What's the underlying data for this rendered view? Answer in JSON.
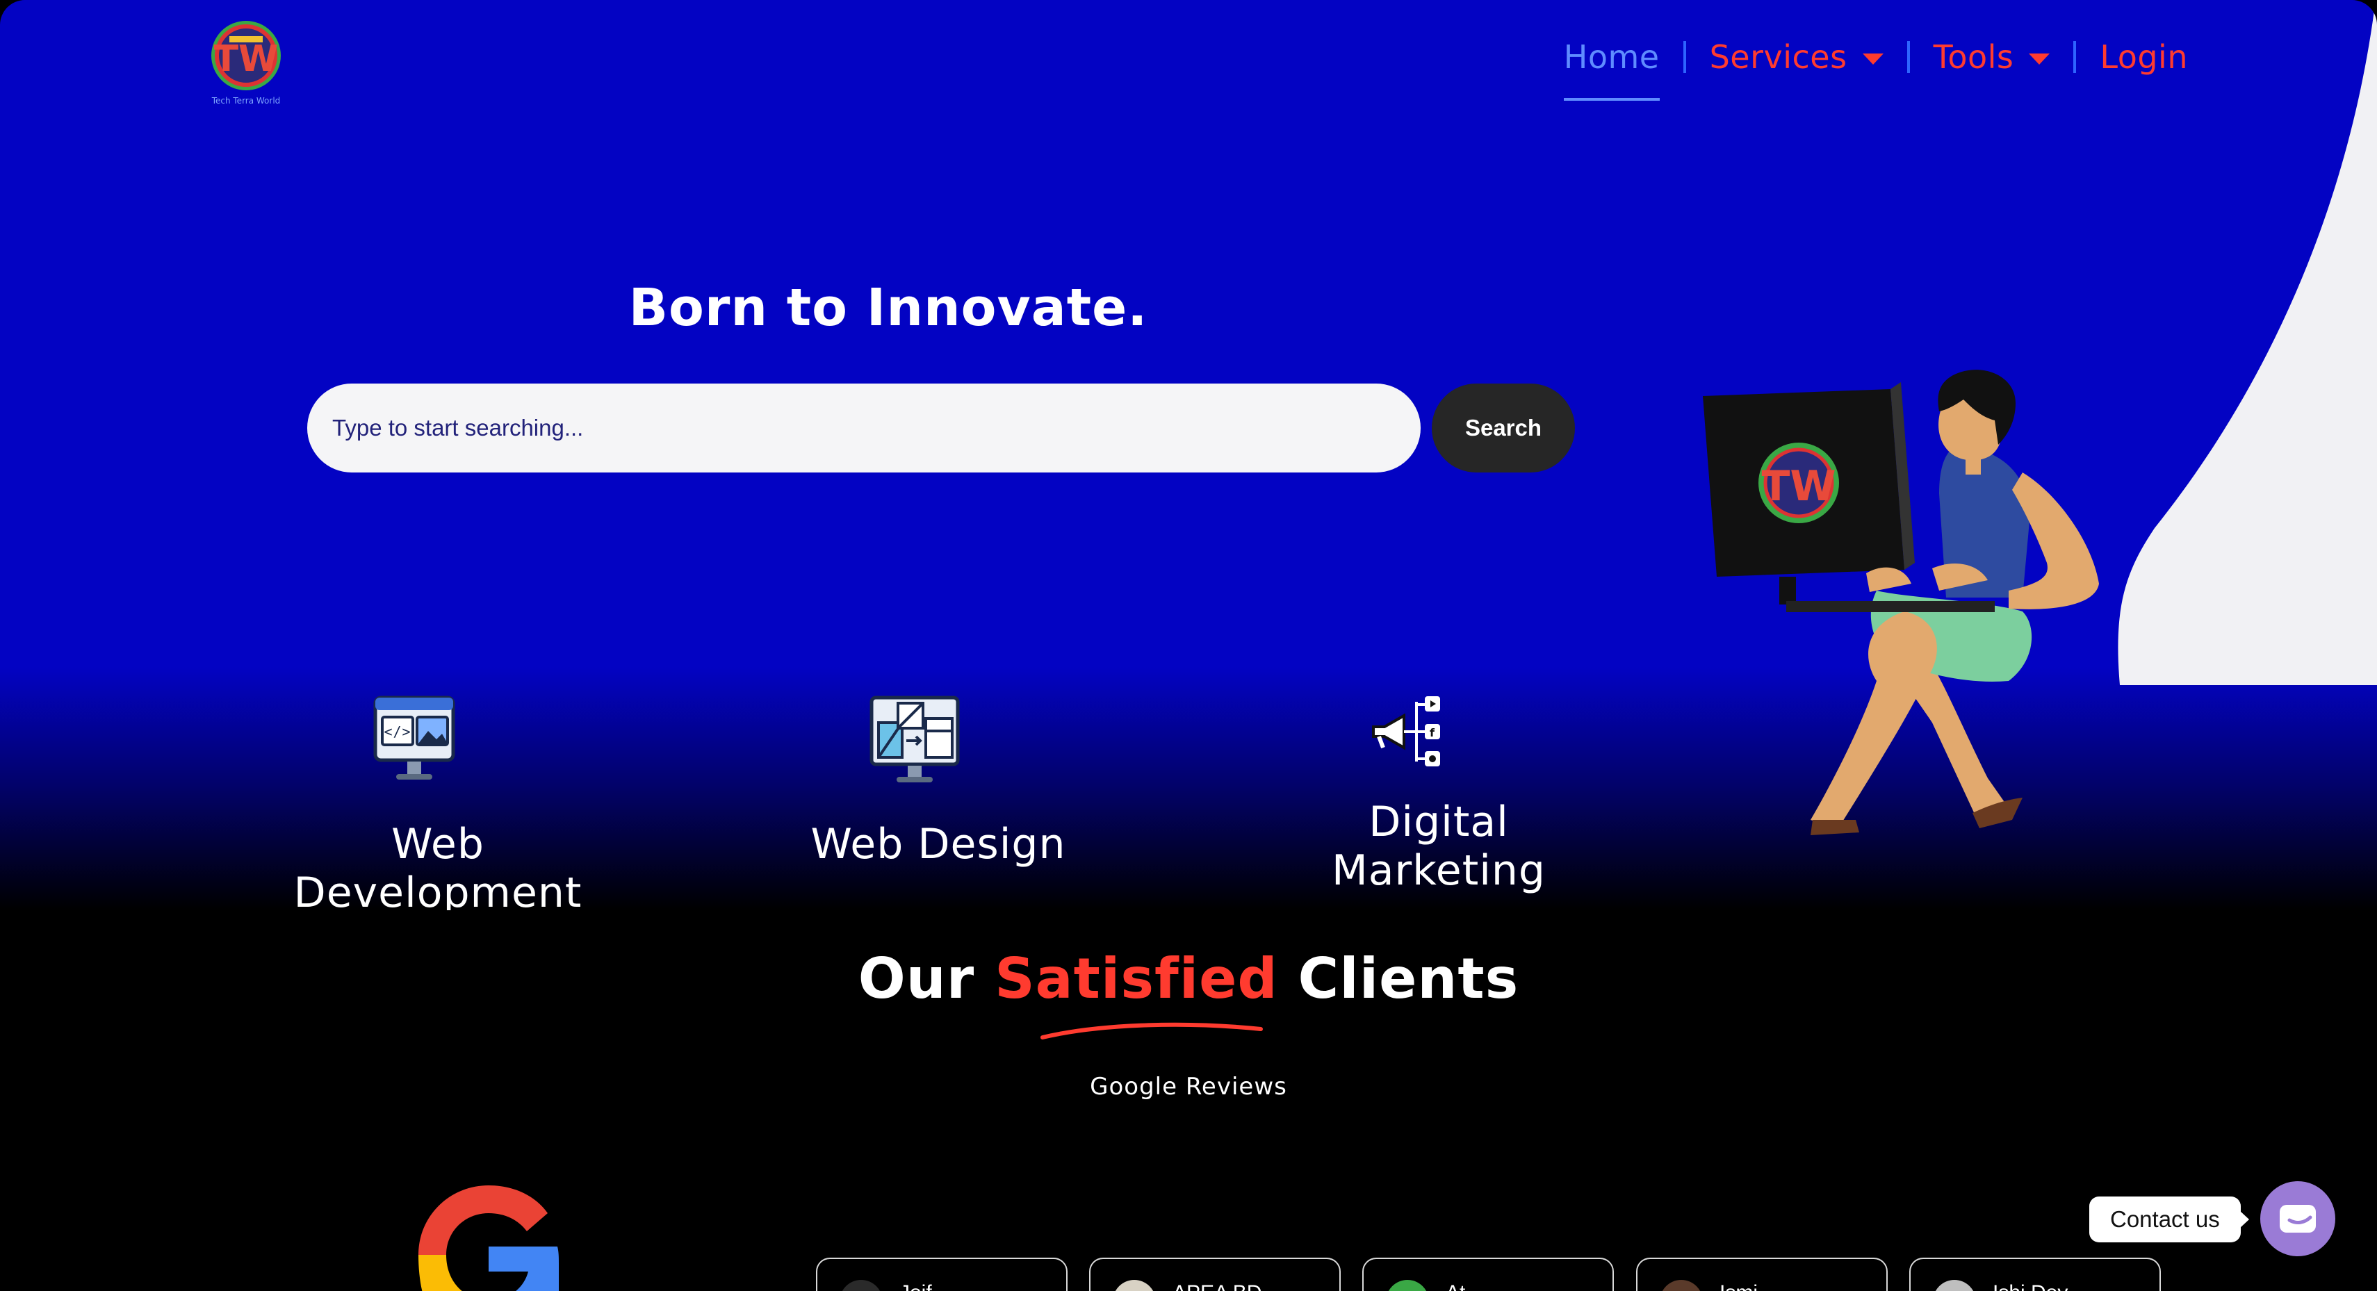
{
  "brand": {
    "logo_caption": "Tech Terra World",
    "logo_letters": "TW"
  },
  "nav": {
    "items": [
      {
        "label": "Home",
        "active": true,
        "has_dropdown": false
      },
      {
        "label": "Services",
        "active": false,
        "has_dropdown": true
      },
      {
        "label": "Tools",
        "active": false,
        "has_dropdown": true
      },
      {
        "label": "Login",
        "active": false,
        "has_dropdown": false
      }
    ]
  },
  "hero": {
    "tagline": "Born to Innovate.",
    "search": {
      "placeholder": "Type to start searching...",
      "value": "",
      "button_label": "Search"
    }
  },
  "services": [
    {
      "label": "Web Development",
      "icon": "code-monitor-icon"
    },
    {
      "label": "Web Design",
      "icon": "layout-monitor-icon"
    },
    {
      "label": "Digital Marketing",
      "icon": "megaphone-icon"
    }
  ],
  "clients": {
    "title_before": "Our ",
    "title_highlight": "Satisfied",
    "title_after": " Clients",
    "subtitle": "Google Reviews",
    "reviews": [
      {
        "name": "Joif...",
        "avatar_color": "#2a2a2a"
      },
      {
        "name": "APEA BD",
        "avatar_color": "#d8d2c4"
      },
      {
        "name": "At...",
        "avatar_color": "#3aa845"
      },
      {
        "name": "Ismi...",
        "avatar_color": "#5a3a2a"
      },
      {
        "name": "Ishi Dev...",
        "avatar_color": "#bfbfbf"
      }
    ]
  },
  "contact": {
    "label": "Contact us"
  },
  "colors": {
    "hero_blue": "#0303c3",
    "accent_red": "#ff3b2f",
    "nav_active": "#5f8cff",
    "search_button": "#262626",
    "contact_button": "#9a7bd6"
  }
}
